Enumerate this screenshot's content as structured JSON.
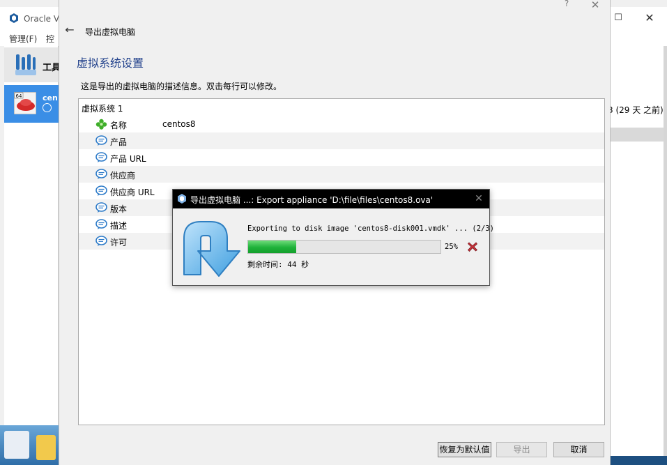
{
  "background_window": {
    "title": "Oracle V",
    "menu": {
      "manage": "管理(F)",
      "control": "控"
    },
    "tools_label": "工具",
    "vm": {
      "name": "cen",
      "os_badge": "64"
    },
    "snapshot_time": "3 (29 天 之前)"
  },
  "wizard": {
    "help": "?",
    "title": "导出虚拟电脑",
    "heading": "虚拟系统设置",
    "description": "这是导出的虚拟电脑的描述信息。双击每行可以修改。",
    "tree": {
      "root": "虚拟系统 1",
      "rows": [
        {
          "key": "名称",
          "value": "centos8",
          "icon": "name-icon"
        },
        {
          "key": "产品",
          "value": "",
          "icon": "comment-icon"
        },
        {
          "key": "产品 URL",
          "value": "",
          "icon": "comment-icon"
        },
        {
          "key": "供应商",
          "value": "",
          "icon": "comment-icon"
        },
        {
          "key": "供应商 URL",
          "value": "",
          "icon": "comment-icon"
        },
        {
          "key": "版本",
          "value": "",
          "icon": "comment-icon"
        },
        {
          "key": "描述",
          "value": "",
          "icon": "comment-icon"
        },
        {
          "key": "许可",
          "value": "",
          "icon": "comment-icon"
        }
      ]
    },
    "buttons": {
      "restore": "恢复为默认值",
      "export": "导出",
      "cancel": "取消"
    }
  },
  "progress": {
    "title": "导出虚拟电脑 ...: Export appliance 'D:\\file\\files\\centos8.ova'",
    "status": "Exporting to disk image 'centos8-disk001.vmdk' ... (2/3)",
    "percent_value": 25,
    "percent_label": "25%",
    "remaining": "剩余时间: 44 秒"
  },
  "colors": {
    "accent_selected": "#3a8ee6",
    "heading": "#1f3f8a",
    "progress_fill": "#1fb23a"
  }
}
